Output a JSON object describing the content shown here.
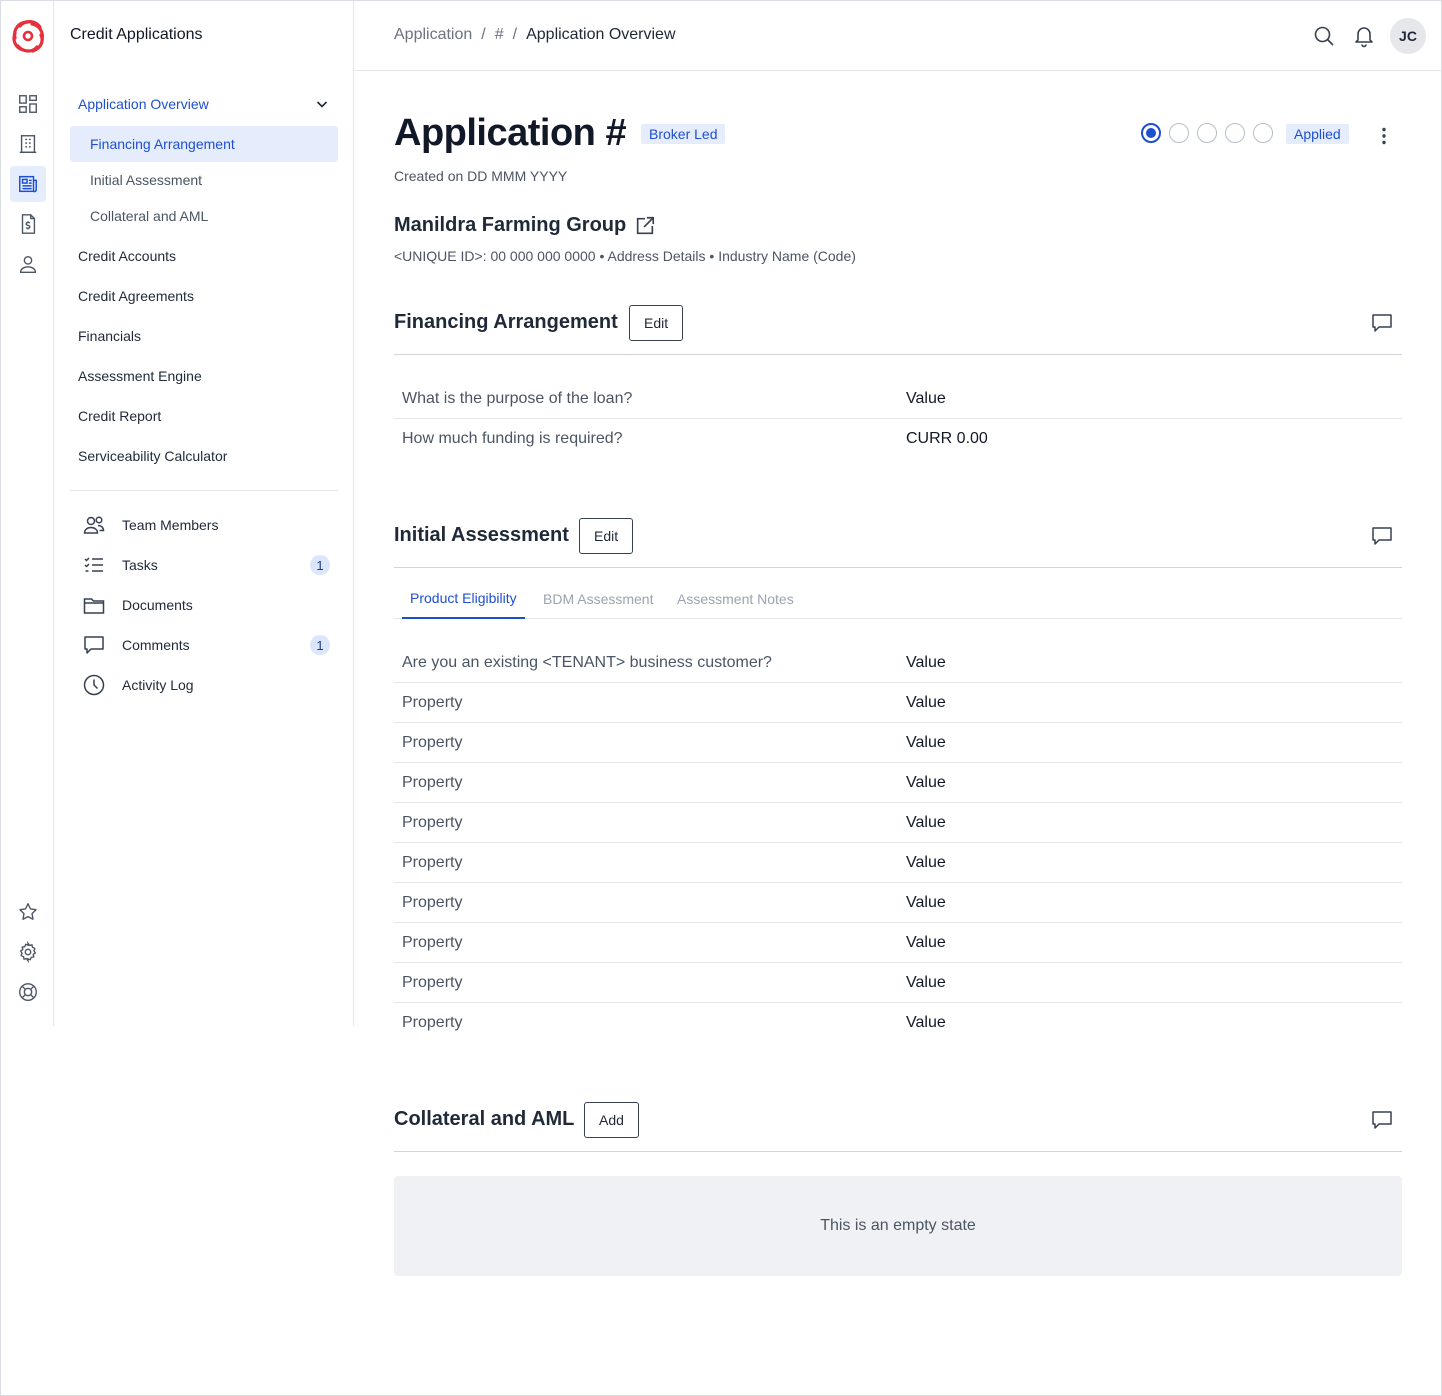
{
  "app": {
    "title": "Credit Applications",
    "brand_color": "#e6313c",
    "accent_color": "#1e4fd0"
  },
  "rail": {
    "items": [
      {
        "icon": "dashboard-icon",
        "active": false
      },
      {
        "icon": "building-icon",
        "active": false
      },
      {
        "icon": "applications-icon",
        "active": true
      },
      {
        "icon": "invoice-dollar-icon",
        "active": false
      },
      {
        "icon": "user-icon",
        "active": false
      }
    ],
    "bottom": [
      "star-icon",
      "settings-gear-icon",
      "help-lifebuoy-icon"
    ]
  },
  "subnav": {
    "section": "Application Overview",
    "sub_items": [
      "Financing Arrangement",
      "Initial Assessment",
      "Collateral and AML"
    ],
    "active_sub": "Financing Arrangement",
    "items": [
      "Credit Accounts",
      "Credit Agreements",
      "Financials",
      "Assessment Engine",
      "Credit Report",
      "Serviceability Calculator"
    ],
    "utilities": [
      {
        "label": "Team Members",
        "icon": "team-icon",
        "count": null
      },
      {
        "label": "Tasks",
        "icon": "tasks-icon",
        "count": "1"
      },
      {
        "label": "Documents",
        "icon": "folder-icon",
        "count": null
      },
      {
        "label": "Comments",
        "icon": "comment-icon",
        "count": "1"
      },
      {
        "label": "Activity Log",
        "icon": "clock-icon",
        "count": null
      }
    ]
  },
  "topbar": {
    "breadcrumb": [
      "Application",
      "#",
      "Application Overview"
    ],
    "avatar_initials": "JC"
  },
  "header": {
    "title": "Application #",
    "type_badge": "Broker Led",
    "created": "Created on DD MMM YYYY",
    "status_badge": "Applied",
    "steps_total": 5,
    "steps_current": 1,
    "company_name": "Manildra Farming Group",
    "company_meta": "<UNIQUE ID>: 00 000 000 0000 • Address Details • Industry Name (Code)"
  },
  "financing": {
    "title": "Financing Arrangement",
    "button": "Edit",
    "rows": [
      {
        "label": "What is the purpose of the loan?",
        "value": "Value"
      },
      {
        "label": "How much funding is required?",
        "value": "CURR 0.00"
      }
    ]
  },
  "assessment": {
    "title": "Initial Assessment",
    "button": "Edit",
    "tabs": [
      "Product Eligibility",
      "BDM Assessment",
      "Assessment Notes"
    ],
    "active_tab": "Product Eligibility",
    "rows": [
      {
        "label": "Are you an existing <TENANT> business customer?",
        "value": "Value"
      },
      {
        "label": "Property",
        "value": "Value"
      },
      {
        "label": "Property",
        "value": "Value"
      },
      {
        "label": "Property",
        "value": "Value"
      },
      {
        "label": "Property",
        "value": "Value"
      },
      {
        "label": "Property",
        "value": "Value"
      },
      {
        "label": "Property",
        "value": "Value"
      },
      {
        "label": "Property",
        "value": "Value"
      },
      {
        "label": "Property",
        "value": "Value"
      },
      {
        "label": "Property",
        "value": "Value"
      }
    ]
  },
  "collateral": {
    "title": "Collateral and AML",
    "button": "Add",
    "empty_state": "This is an empty state"
  }
}
